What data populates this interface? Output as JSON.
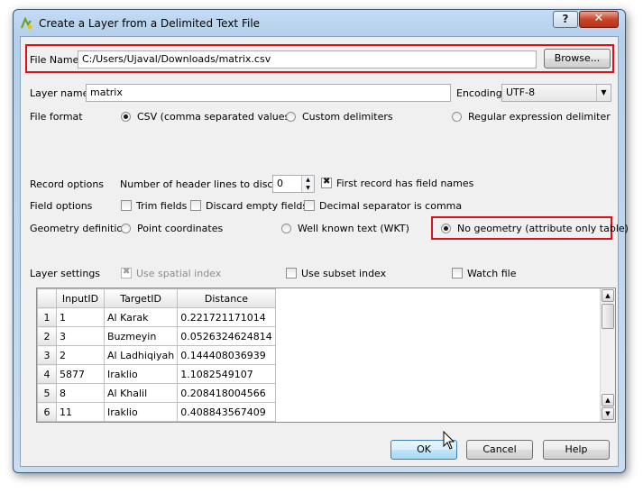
{
  "window": {
    "title": "Create a Layer from a Delimited Text File",
    "help_label": "?",
    "close_label": "✕"
  },
  "file_name": {
    "label": "File Name",
    "value": "C:/Users/Ujaval/Downloads/matrix.csv",
    "browse_label": "Browse..."
  },
  "layer_name": {
    "label": "Layer name",
    "value": "matrix"
  },
  "encoding": {
    "label": "Encoding",
    "value": "UTF-8"
  },
  "file_format": {
    "label": "File format",
    "options": [
      "CSV (comma separated values)",
      "Custom delimiters",
      "Regular expression delimiter"
    ],
    "selected": "CSV (comma separated values)"
  },
  "record_options": {
    "label": "Record options",
    "header_lines_label": "Number of header lines to discard",
    "header_lines_value": "0",
    "first_record_label": "First record has field names"
  },
  "field_options": {
    "label": "Field options",
    "trim": "Trim fields",
    "discard_empty": "Discard empty fields",
    "decimal_comma": "Decimal separator is comma"
  },
  "geometry": {
    "label": "Geometry definition",
    "options": [
      "Point coordinates",
      "Well known text (WKT)",
      "No geometry (attribute only table)"
    ],
    "selected": "No geometry (attribute only table)"
  },
  "layer_settings": {
    "label": "Layer settings",
    "spatial_index": "Use spatial index",
    "subset_index": "Use subset index",
    "watch_file": "Watch file"
  },
  "preview": {
    "columns": [
      "InputID",
      "TargetID",
      "Distance"
    ],
    "rows": [
      {
        "n": "1",
        "cells": [
          "1",
          "Al Karak",
          "0.221721171014"
        ]
      },
      {
        "n": "2",
        "cells": [
          "3",
          "Buzmeyin",
          "0.0526324624814"
        ]
      },
      {
        "n": "3",
        "cells": [
          "2",
          "Al Ladhiqiyah",
          "0.144408036939"
        ]
      },
      {
        "n": "4",
        "cells": [
          "5877",
          "Iraklio",
          "1.1082549107"
        ]
      },
      {
        "n": "5",
        "cells": [
          "8",
          "Al Khalil",
          "0.208418004566"
        ]
      },
      {
        "n": "6",
        "cells": [
          "11",
          "Iraklio",
          "0.408843567409"
        ]
      }
    ]
  },
  "buttons": {
    "ok": "OK",
    "cancel": "Cancel",
    "help": "Help"
  },
  "colors": {
    "highlight_red": "#e0101a",
    "title_blue": "#c4dcf3"
  }
}
